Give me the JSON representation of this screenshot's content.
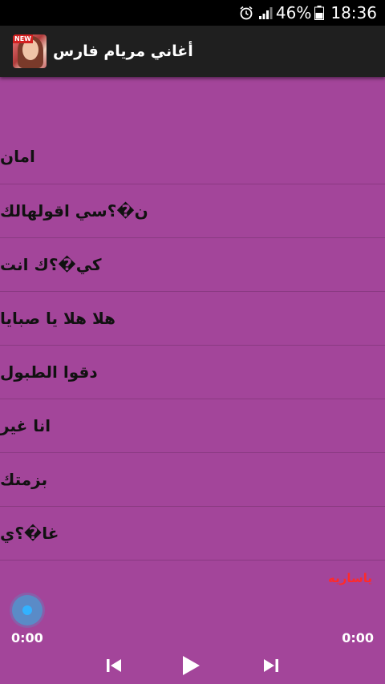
{
  "status": {
    "battery_percent": "46%",
    "time": "18:36"
  },
  "app": {
    "title": "أغاني مريام فارس",
    "icon_badge": "NEW"
  },
  "songs": [
    {
      "title": "امان"
    },
    {
      "title": "ن�؟سي اقولهالك"
    },
    {
      "title": "كي�؟ك انت"
    },
    {
      "title": "هلا هلا يا صبايا"
    },
    {
      "title": "دقوا الطبول"
    },
    {
      "title": "انا غير"
    },
    {
      "title": "بزمتك"
    },
    {
      "title": "غا�؟ي"
    }
  ],
  "player": {
    "current_title": "ياساريه",
    "elapsed": "0:00",
    "duration": "0:00",
    "progress": 0
  },
  "icons": {
    "alarm": "alarm-icon",
    "signal": "signal-icon",
    "battery": "battery-icon",
    "prev": "skip-previous-icon",
    "play": "play-icon",
    "next": "skip-next-icon"
  },
  "colors": {
    "background": "#a3459a",
    "app_bar": "#1f1f1f",
    "current_title": "#ff2a2a",
    "seek_knob": "#32b2ff"
  }
}
